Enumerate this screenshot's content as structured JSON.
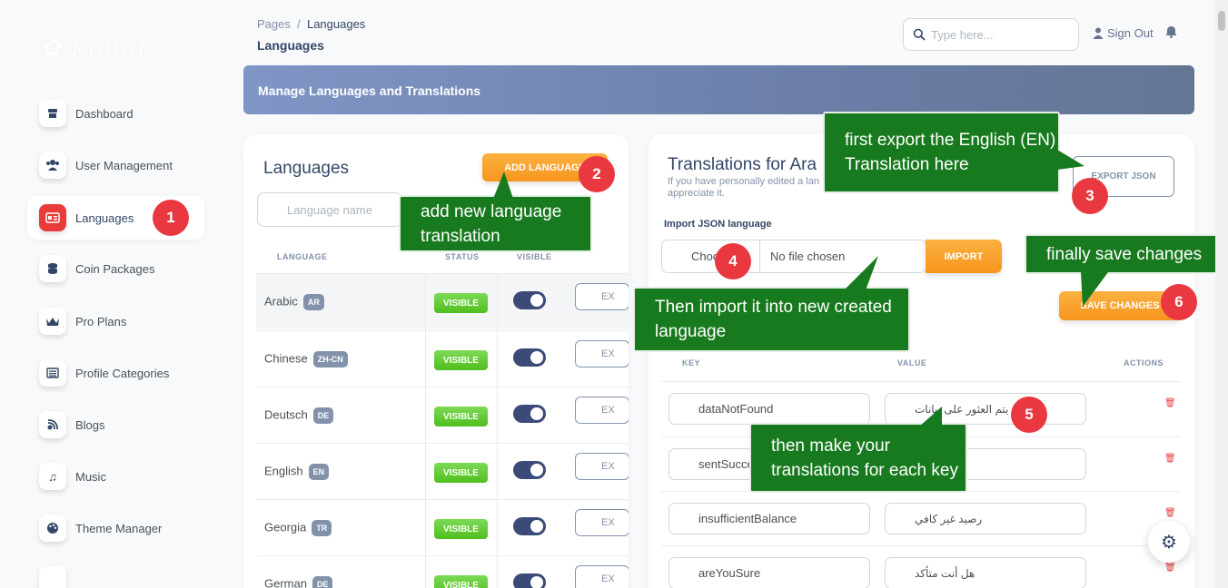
{
  "brand": {
    "logo_text": "Kimat"
  },
  "sidebar": {
    "items": [
      {
        "label": "Dashboard",
        "icon": "store-icon"
      },
      {
        "label": "User Management",
        "icon": "users-icon"
      },
      {
        "label": "Languages",
        "icon": "id-card-icon",
        "active": true
      },
      {
        "label": "Coin Packages",
        "icon": "coins-icon"
      },
      {
        "label": "Pro Plans",
        "icon": "crown-icon"
      },
      {
        "label": "Profile Categories",
        "icon": "list-icon"
      },
      {
        "label": "Blogs",
        "icon": "blog-icon"
      },
      {
        "label": "Music",
        "icon": "music-icon"
      },
      {
        "label": "Theme Manager",
        "icon": "palette-icon"
      }
    ]
  },
  "header": {
    "breadcrumb_root": "Pages",
    "breadcrumb_sep": "/",
    "breadcrumb_current": "Languages",
    "title": "Languages",
    "search_placeholder": "Type here...",
    "signout_label": "Sign Out"
  },
  "banner": {
    "title": "Manage Languages and Translations"
  },
  "languages_card": {
    "title": "Languages",
    "add_button": "ADD LANGUAGE",
    "name_placeholder": "Language name",
    "columns": {
      "language": "LANGUAGE",
      "status": "STATUS",
      "visible": "VISIBLE"
    },
    "rows": [
      {
        "name": "Arabic",
        "code": "AR",
        "status": "VISIBLE",
        "action": "EX"
      },
      {
        "name": "Chinese",
        "code": "ZH-CN",
        "status": "VISIBLE",
        "action": "EX"
      },
      {
        "name": "Deutsch",
        "code": "DE",
        "status": "VISIBLE",
        "action": "EX"
      },
      {
        "name": "English",
        "code": "EN",
        "status": "VISIBLE",
        "action": "EX"
      },
      {
        "name": "Georgia",
        "code": "TR",
        "status": "VISIBLE",
        "action": "EX"
      },
      {
        "name": "German",
        "code": "DE",
        "status": "VISIBLE",
        "action": "EX"
      }
    ]
  },
  "translations_card": {
    "title": "Translations for Ara",
    "subtitle": "If you have personally edited a lan appreciate it.",
    "export_button": "EXPORT JSON",
    "import_label": "Import JSON language",
    "file_choose": "Choo",
    "file_name": "No file chosen",
    "import_button": "IMPORT",
    "save_button": "SAVE CHANGES",
    "columns": {
      "key": "KEY",
      "value": "VALUE",
      "actions": "ACTIONS"
    },
    "rows": [
      {
        "key": "dataNotFound",
        "value": "...لم يتم العثور على بيانات"
      },
      {
        "key": "sentSucce",
        "value": ""
      },
      {
        "key": "insufficientBalance",
        "value": "رصيد غير كافي"
      },
      {
        "key": "areYouSure",
        "value": "هل أنت متأكد"
      }
    ]
  },
  "callouts": {
    "c1": "add new language translation",
    "c3": "first export the English (EN) Translation here",
    "c4": "Then import it into new created language",
    "c5": "then make your translations for each key",
    "c6": "finally save changes"
  },
  "steps": [
    "1",
    "2",
    "3",
    "4",
    "5",
    "6"
  ],
  "colors": {
    "accent_red": "#e9383f",
    "callout_green": "#187a1e",
    "orange": "#f7951d",
    "visible_green": "#4fbf1c"
  }
}
